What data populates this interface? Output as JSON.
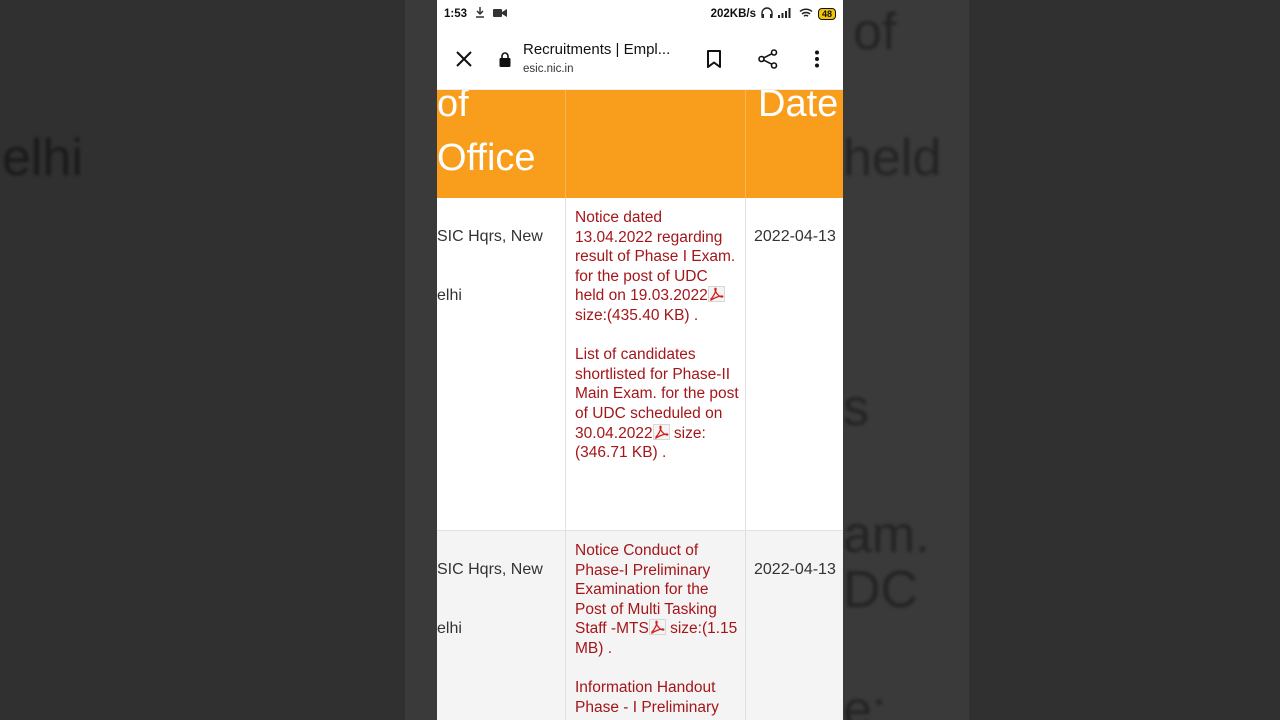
{
  "status_bar": {
    "time": "1:53",
    "speed": "202KB/s",
    "battery": "48"
  },
  "browser": {
    "title": "Recruitments | Empl...",
    "url": "esic.nic.in"
  },
  "table": {
    "headers": {
      "office_line1": "of",
      "office_line2": "Office",
      "date": "Date"
    },
    "rows": [
      {
        "office_line1": "SIC Hqrs, New",
        "office_line2": "elhi",
        "items": [
          {
            "text": "Notice dated 13.04.2022 regarding result of Phase I Exam. for the post of UDC held on 19.03.2022",
            "size": "size:(435.40 KB) ."
          },
          {
            "text": "List of candidates shortlisted for Phase-II Main Exam. for the post of UDC scheduled on 30.04.2022",
            "size": " size:(346.71 KB) ."
          }
        ],
        "date": "2022-04-13"
      },
      {
        "office_line1": "SIC Hqrs, New",
        "office_line2": "elhi",
        "items": [
          {
            "text": "Notice Conduct of Phase-I Preliminary Examination for the Post of Multi Tasking Staff -MTS",
            "size": " size:(1.15 MB) ."
          },
          {
            "text": "Information Handout Phase - I Preliminary",
            "size": ""
          }
        ],
        "date": "2022-04-13"
      }
    ]
  },
  "background": {
    "left_texts": [
      "elhi"
    ],
    "right_texts": [
      "of",
      "held",
      "s",
      "am.",
      "DC",
      "e:"
    ]
  },
  "colors": {
    "header_orange": "#f99d1c",
    "link_red": "#a3161a",
    "backdrop": "#303030"
  }
}
